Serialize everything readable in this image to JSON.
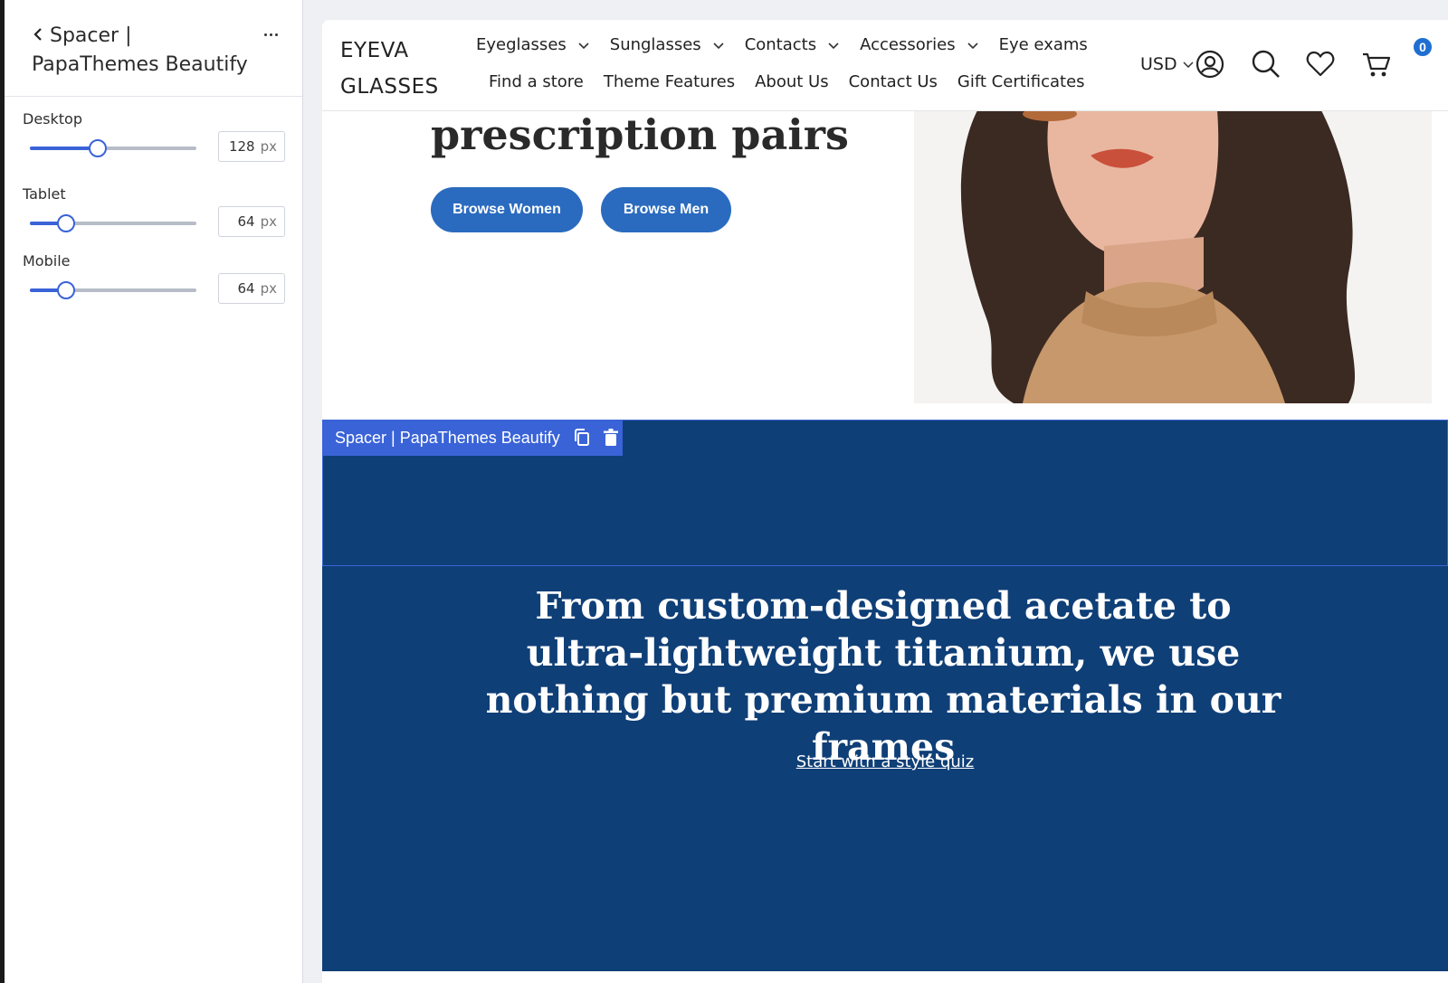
{
  "panel": {
    "title_line1": "Spacer |",
    "title_line2": "PapaThemes Beautify",
    "controls": [
      {
        "label": "Desktop",
        "value": "128",
        "unit": "px",
        "fraction": 0.41
      },
      {
        "label": "Tablet",
        "value": "64",
        "unit": "px",
        "fraction": 0.22
      },
      {
        "label": "Mobile",
        "value": "64",
        "unit": "px",
        "fraction": 0.22
      }
    ]
  },
  "header": {
    "logo_line1": "EYEVA",
    "logo_line2": "GLASSES",
    "nav_row1": [
      "Eyeglasses",
      "Sunglasses",
      "Contacts",
      "Accessories",
      "Eye exams"
    ],
    "nav_row2": [
      "Find a store",
      "Theme Features",
      "About Us",
      "Contact Us",
      "Gift Certificates"
    ],
    "currency": "USD",
    "cart_count": "0"
  },
  "hero": {
    "heading": "prescription pairs",
    "buttons": [
      "Browse Women",
      "Browse Men"
    ]
  },
  "spacer": {
    "tag_label": "Spacer | PapaThemes Beautify"
  },
  "feature": {
    "heading": "From custom-designed acetate to ultra-lightweight titanium, we use nothing but premium materials in our frames",
    "link": "Start with a style quiz"
  },
  "colors": {
    "accent": "#3a63d8",
    "section_bg": "#0f3f77",
    "button_bg": "#2a6bbf",
    "badge_bg": "#1f6fd1"
  }
}
